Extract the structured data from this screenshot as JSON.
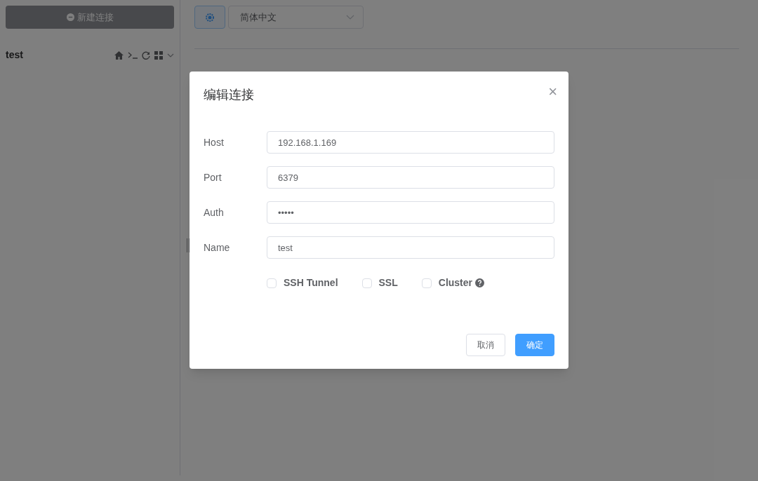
{
  "sidebar": {
    "new_connection_button": "新建连接",
    "connections": [
      {
        "name": "test",
        "expanded": false
      }
    ]
  },
  "toolbar": {
    "language_select": "简体中文"
  },
  "dialog": {
    "title": "编辑连接",
    "close": "×",
    "fields": [
      {
        "label": "Host",
        "value": "192.168.1.169"
      },
      {
        "label": "Port",
        "value": "6379"
      },
      {
        "label": "Auth",
        "value": "•••••"
      },
      {
        "label": "Name",
        "value": "test"
      }
    ],
    "options": [
      {
        "label": "SSH Tunnel",
        "checked": false,
        "help": false
      },
      {
        "label": "SSL",
        "checked": false,
        "help": false
      },
      {
        "label": "Cluster",
        "checked": false,
        "help": true
      }
    ],
    "buttons": [
      {
        "label": "取消",
        "kind": "default"
      },
      {
        "label": "确定",
        "kind": "primary"
      }
    ]
  }
}
